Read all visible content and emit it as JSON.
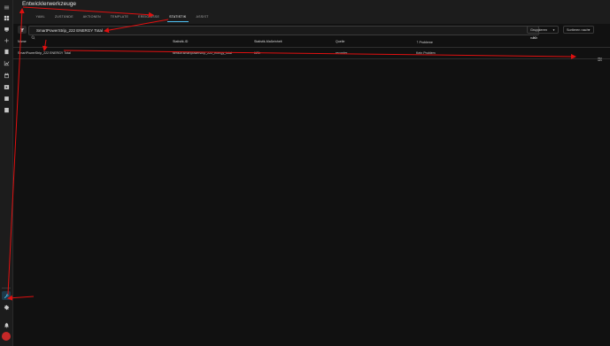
{
  "app": {
    "title": "Entwicklerwerkzeuge"
  },
  "tabs": [
    "YAML",
    "ZUSTÄNDE",
    "AKTIONEN",
    "TEMPLATE",
    "EREIGNISSE",
    "STATISTIK",
    "ASSIST"
  ],
  "active_tab": "STATISTIK",
  "search": {
    "value": "SmartPowerStrip_222 ENERGY Total"
  },
  "toolbar": {
    "group_label": "Gruppieren nach",
    "sort_label": "Sortieren nach"
  },
  "table": {
    "columns": [
      "Name",
      "Statistik-ID",
      "Statistik-Maßeinheit",
      "Quelle",
      "Probleme"
    ],
    "rows": [
      {
        "name": "SmartPowerStrip_222 ENERGY Total",
        "statistic_id": "sensor.smartpowerstrip_222_energy_total",
        "unit": "kWh",
        "source": "recorder",
        "issues": "Kein Problem"
      }
    ]
  },
  "sidebar": {
    "icons": [
      "menu-icon",
      "overview-icon",
      "energy-icon",
      "map-icon",
      "logbook-icon",
      "history-icon",
      "calendar-icon",
      "media-icon",
      "todo-icon",
      "developer-tools-icon",
      "settings-icon",
      "notifications-icon",
      "user-avatar"
    ]
  },
  "colors": {
    "accent": "#4fc3f7",
    "annotation": "#e01010",
    "background": "#111111"
  }
}
